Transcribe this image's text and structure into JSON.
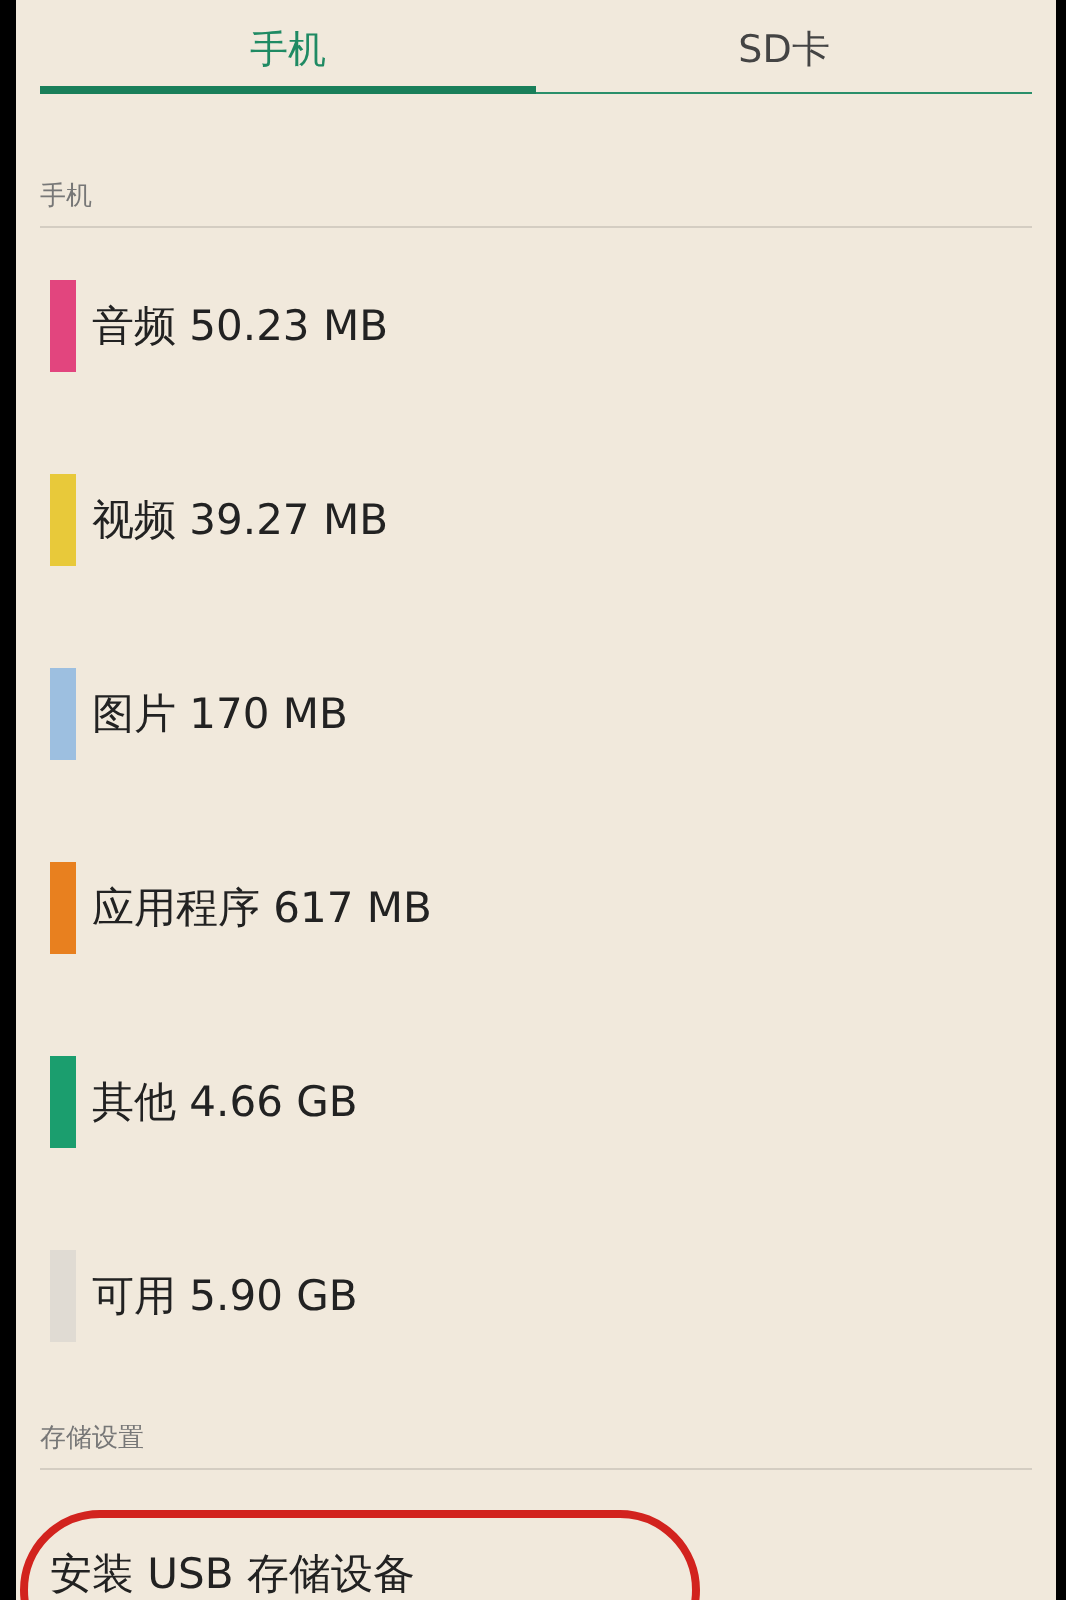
{
  "tabs": [
    {
      "label": "手机",
      "selected": true
    },
    {
      "label": "SD卡",
      "selected": false
    }
  ],
  "sections": [
    {
      "title": "手机",
      "items": [
        {
          "label": "音频 50.23 MB",
          "color": "#e2457e"
        },
        {
          "label": "视频 39.27 MB",
          "color": "#e8c93a"
        },
        {
          "label": "图片 170 MB",
          "color": "#9dbfe0"
        },
        {
          "label": "应用程序 617 MB",
          "color": "#e8801f"
        },
        {
          "label": "其他 4.66 GB",
          "color": "#1b9e6e"
        },
        {
          "label": "可用 5.90 GB",
          "color": "#e0dbd3"
        }
      ]
    },
    {
      "title": "存储设置",
      "actions": [
        {
          "label": "安装 USB 存储设备",
          "circled": true
        }
      ]
    }
  ]
}
